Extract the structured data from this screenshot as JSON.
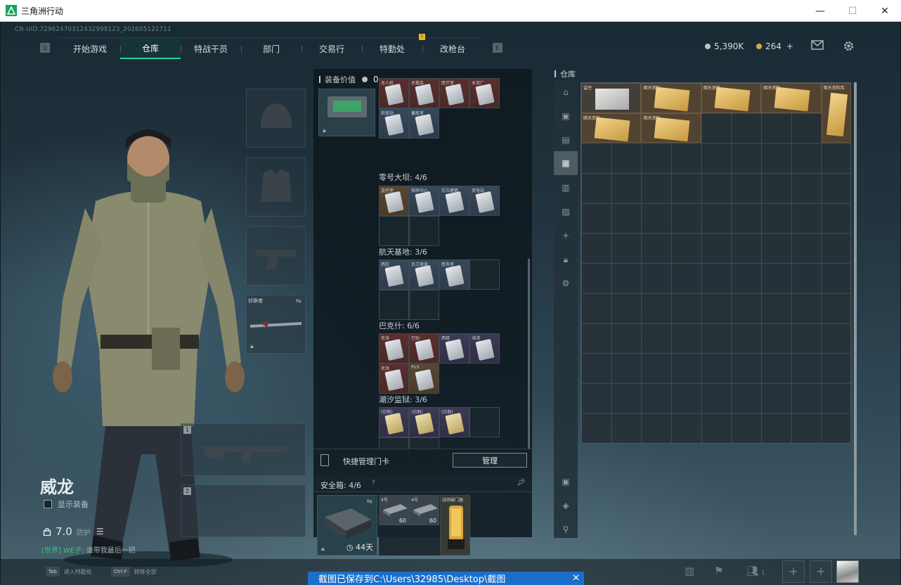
{
  "window": {
    "title": "三角洲行动",
    "minimize": "—",
    "maximize": "☐",
    "close": "✕"
  },
  "uid": "CN-UID:729624703124329981​23_202605121711",
  "nav": {
    "tabs": [
      "开始游戏",
      "仓库",
      "特战干员",
      "部门",
      "交易行",
      "特勤处",
      "改枪台"
    ],
    "active_index": 1
  },
  "currency": {
    "hafcoin": "5,390K",
    "coupons": "264",
    "plus": "+"
  },
  "operator": {
    "name": "威龙",
    "show_equipment_label": "显示装备",
    "armor_value": "7.0",
    "armor_sub": "防护",
    "chat_channel": "[世界] WE子:",
    "chat_text": "谁带我最后一把"
  },
  "weapon_slot": {
    "name": "侦察者"
  },
  "primary_slots": [
    "1",
    "2"
  ],
  "middle": {
    "equip_value_label": "装备价值",
    "equip_value": "0",
    "sections": [
      {
        "label": "零号大坝: 4/6"
      },
      {
        "label": "航天基地: 3/6"
      },
      {
        "label": "巴克什: 6/6"
      },
      {
        "label": "潮汐监狱: 3/6"
      }
    ],
    "card_tags_top": [
      "无人机",
      "总裁会",
      "医疗室",
      "水泥厂",
      "检查站",
      "蓄能室"
    ],
    "card_tags_s1": [
      "监控室",
      "指挥中心",
      "仿古建筑",
      "变电站"
    ],
    "card_tags_s2": [
      "西区",
      "员工宿舍",
      "医务室"
    ],
    "card_tags_s3": [
      "老洪",
      "巴别",
      "西楼",
      "海湾",
      "老洪",
      "Pick"
    ],
    "card_tags_s4": [
      "(仿制)",
      "(仿制)",
      "(仿制)"
    ],
    "quick_manage_label": "快捷管理门卡",
    "manage_button": "管理",
    "safe_label": "安全箱: 4/6",
    "safe_days": "44天",
    "safe_items": [
      {
        "tag": "4号",
        "qty": "60"
      },
      {
        "tag": "4号",
        "qty": "60"
      }
    ],
    "gold_item_tag": "战场破门器"
  },
  "warehouse": {
    "title": "仓库",
    "items": [
      {
        "tag": "监控"
      },
      {
        "tag": "暗天资料"
      },
      {
        "tag": "暗天资料"
      },
      {
        "tag": "暗天资料"
      },
      {
        "tag": "暗天资料库"
      },
      {
        "tag": "暗天资料"
      },
      {
        "tag": "暗天资料"
      }
    ]
  },
  "bottom": {
    "hint1_key": "Tab",
    "hint1_text": "进入特勤处",
    "hint2_key": "Ctrl F",
    "hint2_text": "转移全部",
    "friends_count": "1"
  },
  "toast": {
    "text": "截图已保存到C:\\Users\\32985\\Desktop\\截图",
    "close": "✕"
  },
  "colors": {
    "accent": "#26d39a",
    "toast": "#1c6fc9",
    "gold": "#e6b52a"
  }
}
